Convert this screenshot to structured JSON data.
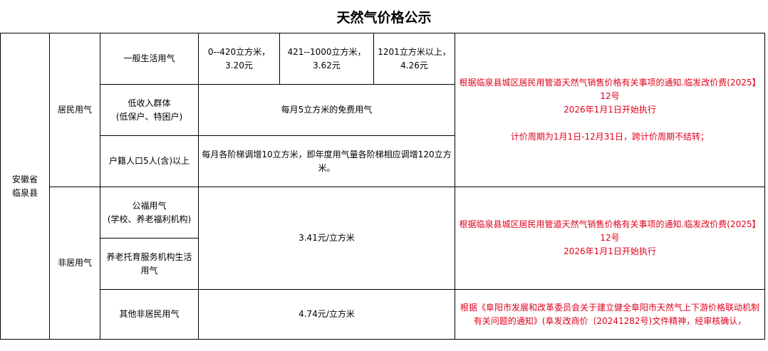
{
  "title": "天然气价格公示",
  "region": {
    "line1": "安徽省",
    "line2": "临泉县"
  },
  "residential": {
    "label": "居民用气",
    "general": {
      "label": "一般生活用气",
      "tiers": [
        {
          "range": "0--420立方米，",
          "price": "3.20元"
        },
        {
          "range": "421--1000立方米，",
          "price": "3.62元"
        },
        {
          "range": "1201立方米以上，",
          "price": "4.26元"
        }
      ]
    },
    "low_income": {
      "label_line1": "低收入群体",
      "label_line2": "(低保户、特困户)",
      "value": "每月5立方米的免费用气"
    },
    "household": {
      "label": "户籍人口5人(含)以上",
      "value": "每月各阶梯调增10立方米，即年度用气量各阶梯相应调增120立方米。"
    },
    "note": {
      "line1": "根据临泉县城区居民用管道天然气销售价格有关事项的通知.临发改价费(2025】12号",
      "line2": "2026年1月1日开始执行",
      "line3": "计价周期为1月1日-12月31日，跨计价周期不结转；"
    }
  },
  "non_residential": {
    "label": "非居用气",
    "public": {
      "label_line1": "公福用气",
      "label_line2": "(学校、养老福利机构)"
    },
    "elderly": {
      "label": "养老托育服务机构生活用气"
    },
    "shared_price": "3.41元/立方米",
    "note": {
      "line1": "根据临泉县城区居民用管道天然气销售价格有关事项的通知.临发改价费(2025】12号",
      "line2": "2026年1月1日开始执行"
    },
    "other": {
      "label": "其他非居民用气",
      "price": "4.74元/立方米",
      "note": "根据《阜阳市发展和改革委员会关于建立健全阜阳市天然气上下游价格联动机制有关问题的通知》(阜发改商价〔20241282号)文件精神，经审核确认，"
    }
  }
}
